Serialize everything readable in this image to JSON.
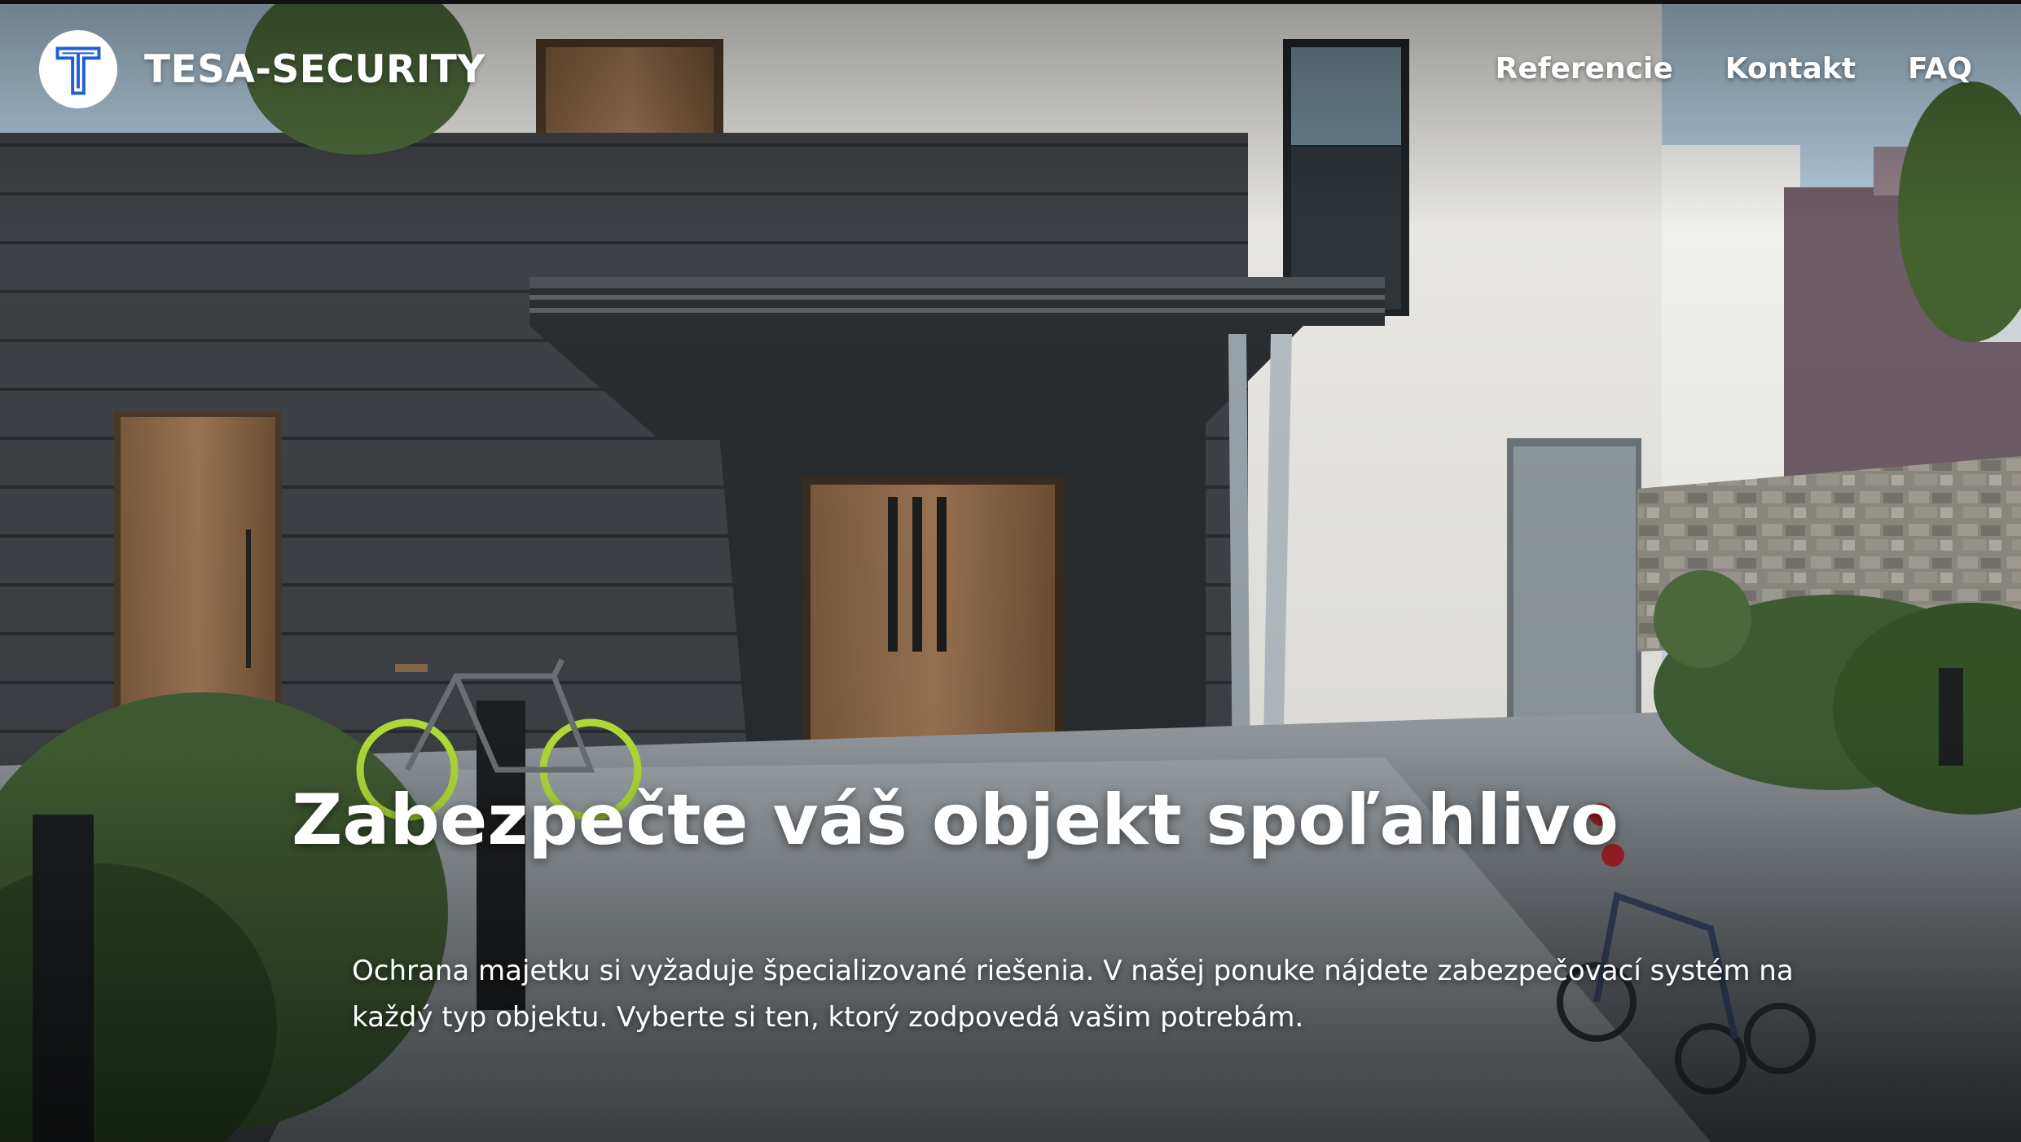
{
  "brand": {
    "name": "TESA-SECURITY",
    "logo_icon": "t-monogram-logo-icon",
    "accent_color": "#1f5fd6"
  },
  "nav": {
    "items": [
      {
        "label": "Referencie"
      },
      {
        "label": "Kontakt"
      },
      {
        "label": "FAQ"
      }
    ]
  },
  "hero": {
    "headline": "Zabezpečte váš objekt spoľahlivo",
    "description": "Ochrana majetku si vyžaduje špecializované riešenia. V našej ponuke nájdete zabezpečovací systém na každý typ objektu. Vyberte si ten, ktorý zodpovedá vašim potrebám."
  }
}
